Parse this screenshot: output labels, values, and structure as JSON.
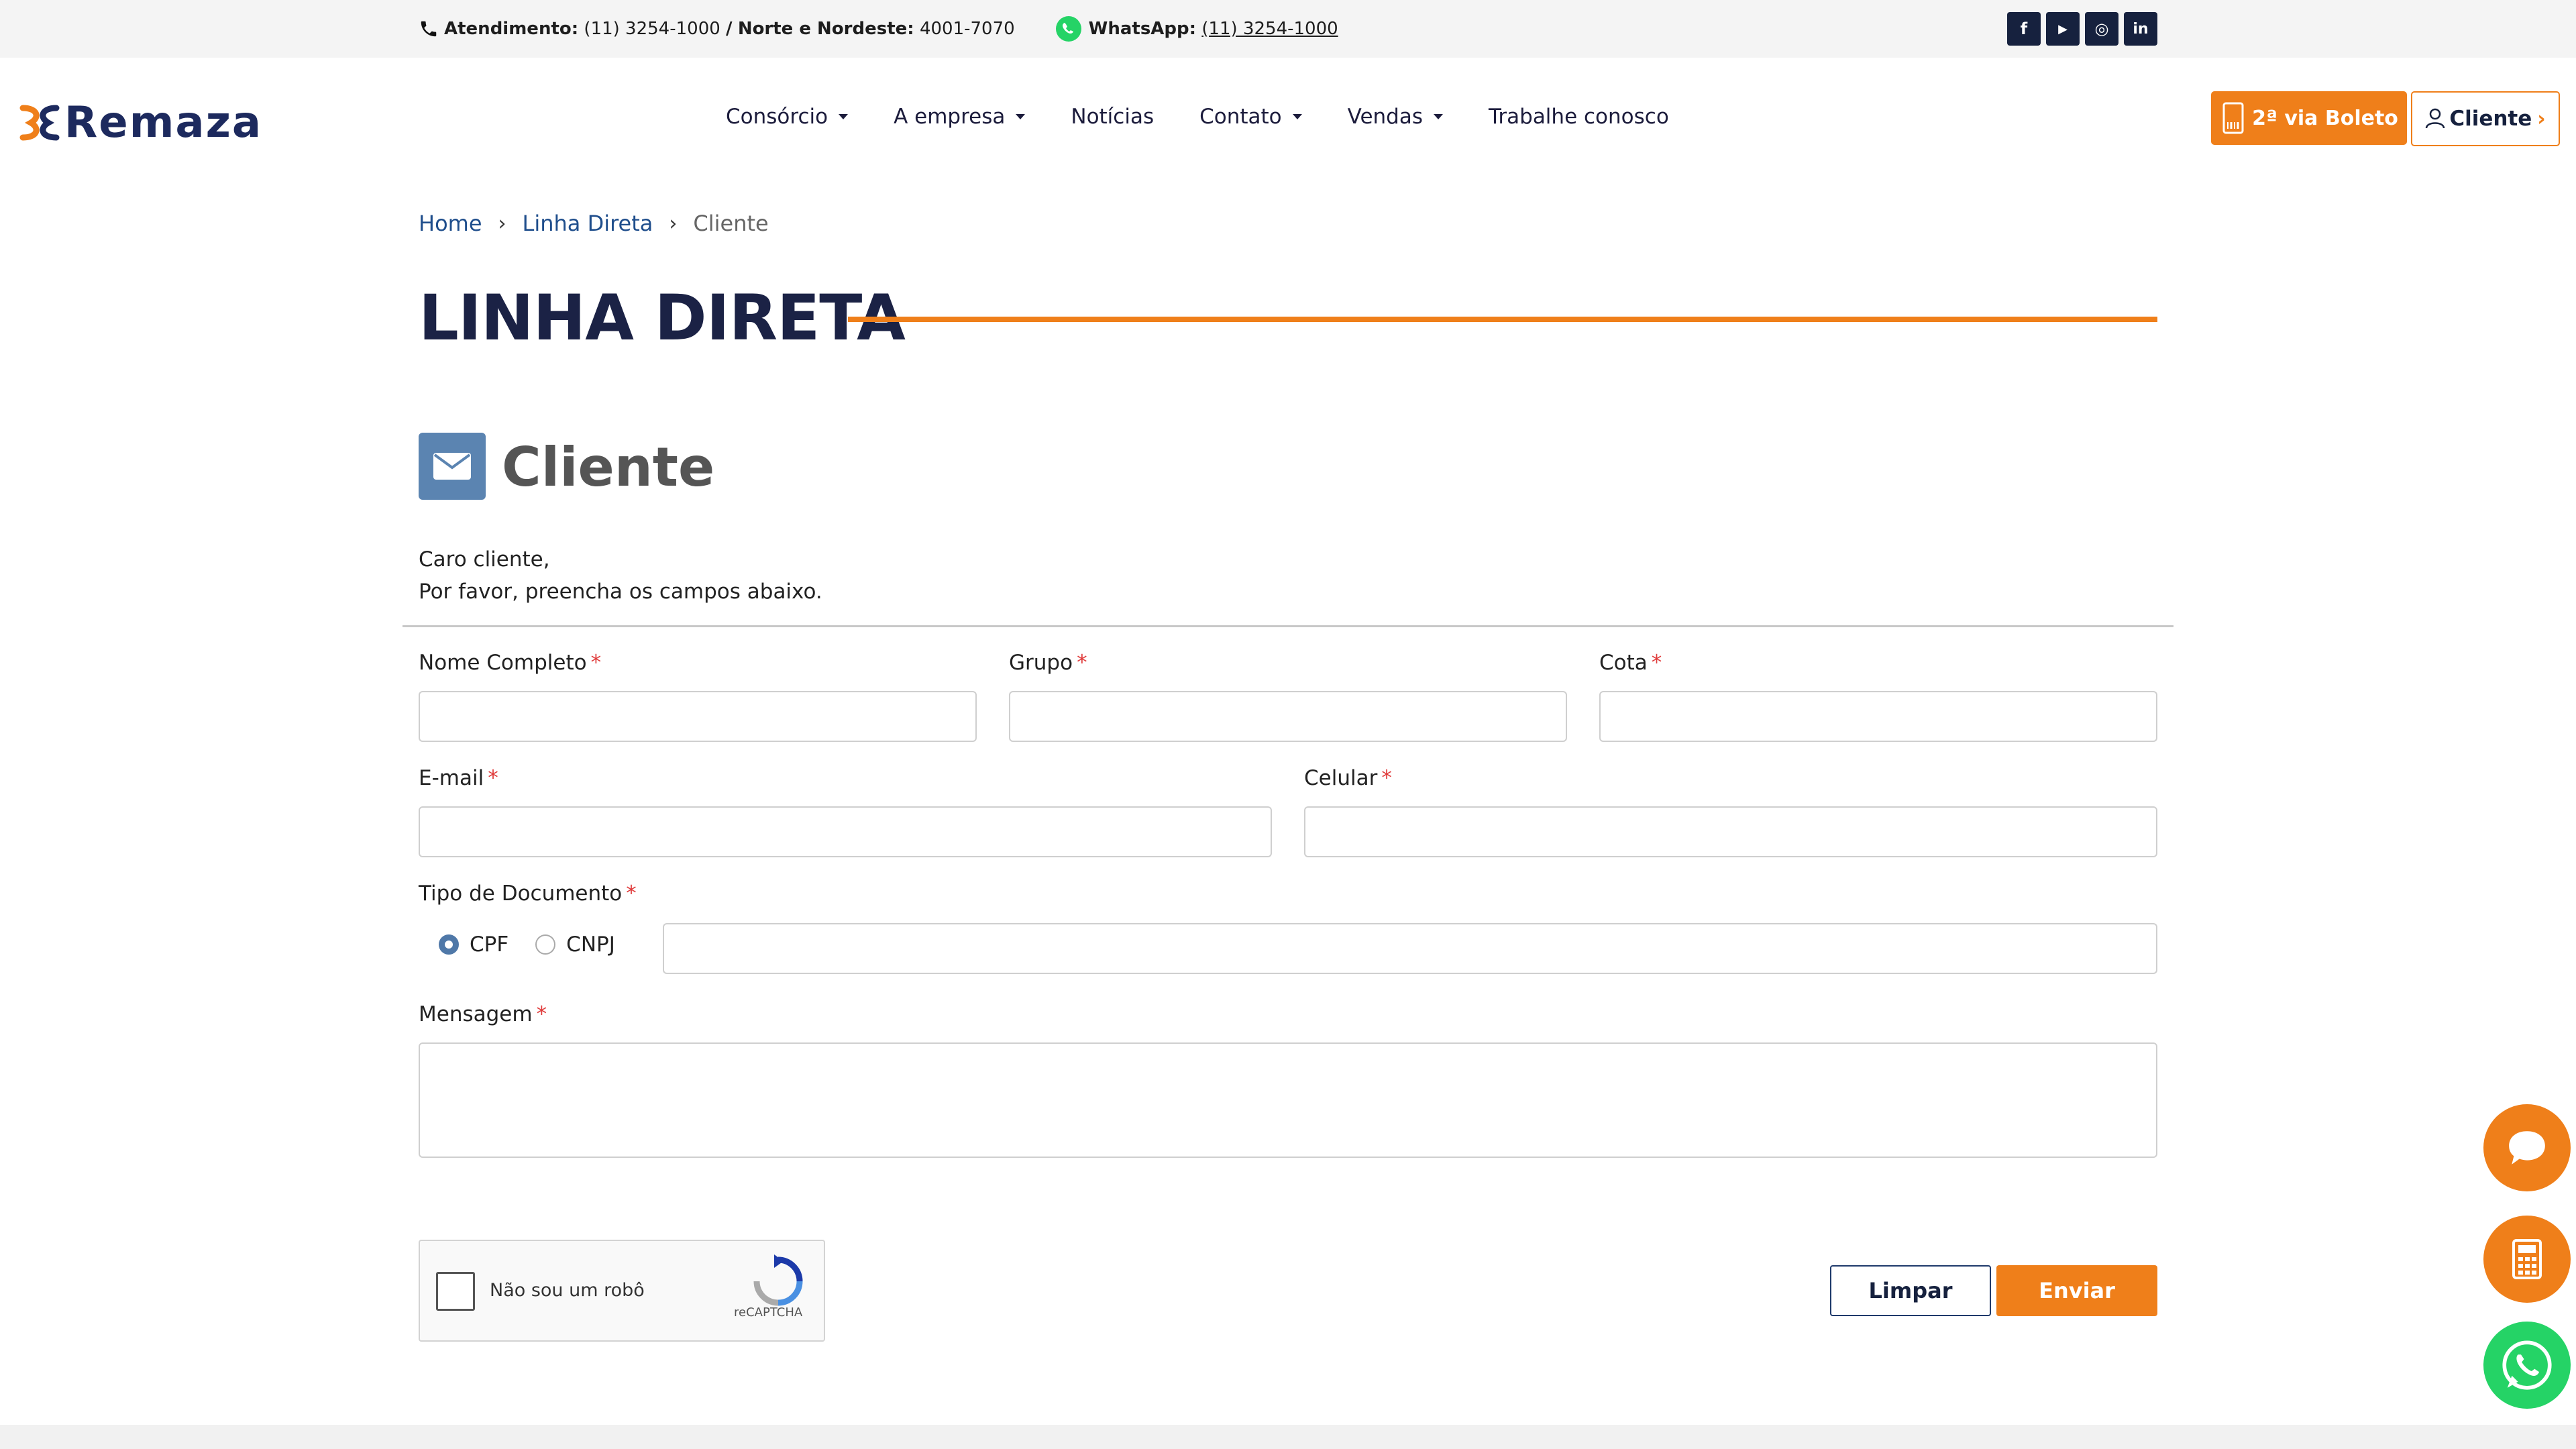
{
  "topbar": {
    "atendimento_label": "Atendimento:",
    "atendimento_number": "(11) 3254-1000",
    "slash": "/",
    "nordeste_label": "Norte e Nordeste:",
    "nordeste_number": "4001-7070",
    "whatsapp_label": "WhatsApp:",
    "whatsapp_number": "(11) 3254-1000",
    "socials": [
      {
        "icon": "facebook-icon",
        "glyph": "f"
      },
      {
        "icon": "youtube-icon",
        "glyph": "▶"
      },
      {
        "icon": "instagram-icon",
        "glyph": "◎"
      },
      {
        "icon": "linkedin-icon",
        "glyph": "in"
      }
    ]
  },
  "header": {
    "logo_text": "Remaza",
    "nav": [
      {
        "label": "Consórcio",
        "dropdown": true
      },
      {
        "label": "A empresa",
        "dropdown": true
      },
      {
        "label": "Notícias",
        "dropdown": false
      },
      {
        "label": "Contato",
        "dropdown": true
      },
      {
        "label": "Vendas",
        "dropdown": true
      },
      {
        "label": "Trabalhe conosco",
        "dropdown": false
      }
    ],
    "boleto_label": "2ª via Boleto",
    "cliente_label": "Cliente"
  },
  "breadcrumb": {
    "home": "Home",
    "section": "Linha Direta",
    "current": "Cliente",
    "sep": "›"
  },
  "page": {
    "title": "LINHA DIRETA",
    "section_title": "Cliente",
    "intro_line1": "Caro cliente,",
    "intro_line2": "Por favor, preencha os campos abaixo."
  },
  "form": {
    "required_mark": "*",
    "nome_label": "Nome Completo",
    "grupo_label": "Grupo",
    "cota_label": "Cota",
    "email_label": "E-mail",
    "celular_label": "Celular",
    "tipo_label": "Tipo de Documento",
    "cpf_label": "CPF",
    "cnpj_label": "CNPJ",
    "mensagem_label": "Mensagem",
    "captcha_label": "Não sou um robô",
    "captcha_brand": "reCAPTCHA",
    "limpar_label": "Limpar",
    "enviar_label": "Enviar"
  },
  "colors": {
    "accent": "#ef7f1a",
    "navy": "#1b2245",
    "icon_blue": "#5b84b1",
    "whatsapp": "#25d366"
  }
}
